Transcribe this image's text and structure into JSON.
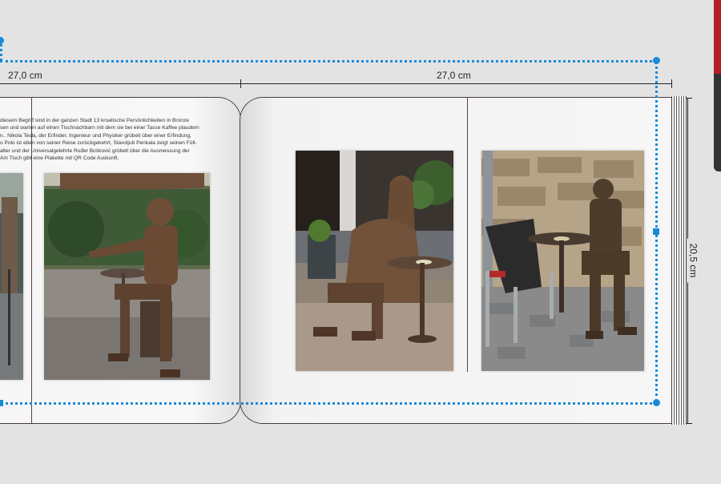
{
  "rulers": {
    "left_width": "27,0 cm",
    "right_width": "27,0 cm",
    "height": "20,5 cm"
  },
  "left_page": {
    "text_lines": [
      "diesem Begriff sind in der ganzen Stadt 13 kroatische Persönlichkeiten in Bronze",
      "sen und warten auf einen Tischnachbarn mit dem sie bei einer Tasse Kaffee plaudern",
      "n.. Nikola Tesla, der Erfinder, Ingenieur und Physiker grübelt über einer Erfindung,",
      "o Polo ist eben von seiner Reise zurückgekehrt,  Slavoljub Penkala zeigt seinen Füll-",
      "alter und der Universalgelehrte Ruđer Bošković grübelt über die Ausmessung der",
      "Am Tisch gibt eine Plakette mit QR Code Auskunft."
    ]
  },
  "colors": {
    "selection": "#1a8ad8",
    "accent": "#b41f25"
  }
}
